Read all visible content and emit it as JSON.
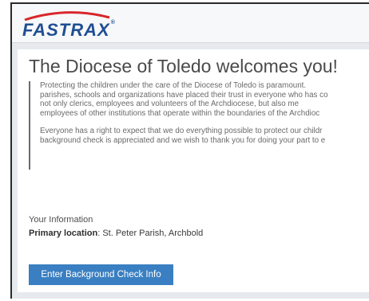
{
  "brand": {
    "name": "FASTRAX",
    "trademark": "®",
    "color": "#1f4f93",
    "arc_color": "#d9262b"
  },
  "page": {
    "title": "The Diocese of Toledo welcomes you!"
  },
  "message": {
    "paragraph1_lines": [
      "Protecting the children under the care of the Diocese of Toledo is paramount.",
      "parishes, schools and organizations have placed their trust in everyone who has co",
      "not only clerics, employees and volunteers of the Archdiocese, but also me",
      "employees of other institutions that operate within the boundaries of the Archdioc"
    ],
    "paragraph2_lines": [
      "Everyone has a right to expect that we do everything possible to protect our childr",
      "background check is appreciated and we wish to thank you for doing your part to e"
    ]
  },
  "info": {
    "heading": "Your Information",
    "primary_location_label": "Primary location",
    "primary_location_value": ": St. Peter Parish, Archbold"
  },
  "actions": {
    "enter_button_label": "Enter Background Check Info",
    "button_color": "#3a7fc1"
  }
}
